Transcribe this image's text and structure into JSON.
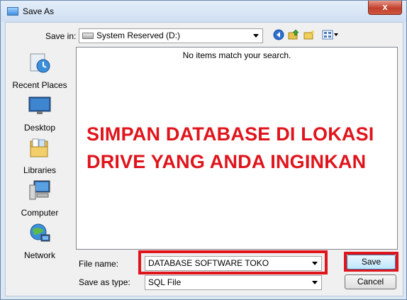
{
  "window": {
    "title": "Save As",
    "close_label": "x",
    "close_icon": "close-icon"
  },
  "toolbar": {
    "save_in_label": "Save in:",
    "location": "System Reserved (D:)",
    "location_icon": "drive-icon",
    "icons": [
      "back-icon",
      "up-folder-icon",
      "new-folder-icon",
      "view-menu-icon"
    ]
  },
  "places": [
    {
      "label": "Recent Places",
      "icon": "recent-places-icon"
    },
    {
      "label": "Desktop",
      "icon": "desktop-icon"
    },
    {
      "label": "Libraries",
      "icon": "libraries-icon"
    },
    {
      "label": "Computer",
      "icon": "computer-icon"
    },
    {
      "label": "Network",
      "icon": "network-icon"
    }
  ],
  "file_list": {
    "empty_message": "No items match your search."
  },
  "annotation": {
    "line1": "SIMPAN DATABASE DI LOKASI",
    "line2": "DRIVE YANG ANDA INGINKAN",
    "color": "#e0141c"
  },
  "form": {
    "file_name_label": "File name:",
    "file_name_value": "DATABASE SOFTWARE TOKO",
    "save_as_type_label": "Save as type:",
    "save_as_type_value": "SQL File"
  },
  "buttons": {
    "save": "Save",
    "cancel": "Cancel"
  }
}
